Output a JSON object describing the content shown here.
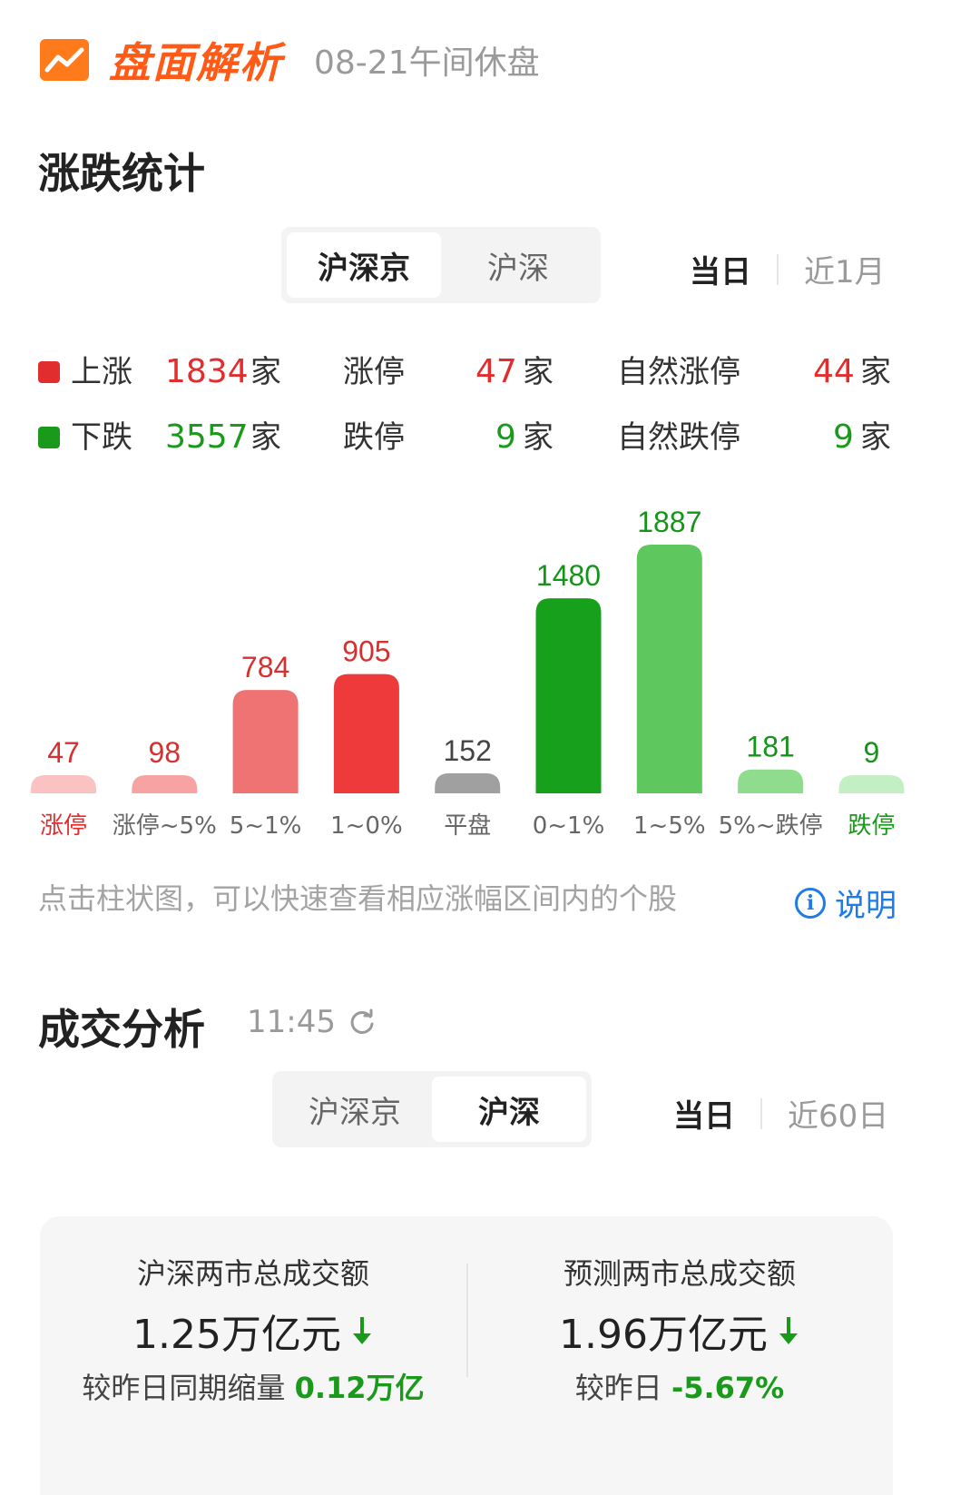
{
  "header": {
    "brand": "盘面解析",
    "date_status": "08-21午间休盘"
  },
  "rise_fall": {
    "title": "涨跌统计",
    "markets": [
      "沪深京",
      "沪深"
    ],
    "active_market": "沪深京",
    "ranges": [
      "当日",
      "近1月"
    ],
    "active_range": "当日",
    "unit": "家",
    "rows": [
      {
        "label": "上涨",
        "count": "1834",
        "limit_label": "涨停",
        "limit_count": "47",
        "natural_label": "自然涨停",
        "natural_count": "44",
        "color": "#e12d2d"
      },
      {
        "label": "下跌",
        "count": "3557",
        "limit_label": "跌停",
        "limit_count": "9",
        "natural_label": "自然跌停",
        "natural_count": "9",
        "color": "#1a9a1a"
      }
    ],
    "hint": "点击柱状图，可以快速查看相应涨幅区间内的个股",
    "explain_label": "说明"
  },
  "chart_data": {
    "type": "bar",
    "categories": [
      "涨停",
      "涨停~5%",
      "5~1%",
      "1~0%",
      "平盘",
      "0~1%",
      "1~5%",
      "5%~跌停",
      "跌停"
    ],
    "values": [
      47,
      98,
      784,
      905,
      152,
      1480,
      1887,
      181,
      9
    ],
    "colors": [
      "#fbc2c2",
      "#f7a3a3",
      "#f07373",
      "#ee3a3a",
      "#a0a0a0",
      "#17a01b",
      "#5ec75e",
      "#8fdc8f",
      "#c4efc4"
    ],
    "label_colors": [
      "#d63030",
      "#d63030",
      "#d63030",
      "#d63030",
      "#444444",
      "#16941a",
      "#16941a",
      "#16941a",
      "#16941a"
    ],
    "category_colors": [
      "#e12d2d",
      "#666666",
      "#666666",
      "#666666",
      "#666666",
      "#666666",
      "#666666",
      "#666666",
      "#1a9a1a"
    ]
  },
  "volume": {
    "title": "成交分析",
    "time": "11:45",
    "markets": [
      "沪深京",
      "沪深"
    ],
    "active_market": "沪深",
    "ranges": [
      "当日",
      "近60日"
    ],
    "active_range": "当日",
    "left": {
      "label": "沪深两市总成交额",
      "value": "1.25万亿元",
      "sub_label": "较昨日同期缩量",
      "sub_value": "0.12万亿"
    },
    "right": {
      "label": "预测两市总成交额",
      "value": "1.96万亿元",
      "sub_label": "较昨日",
      "sub_value": "-5.67%"
    }
  }
}
